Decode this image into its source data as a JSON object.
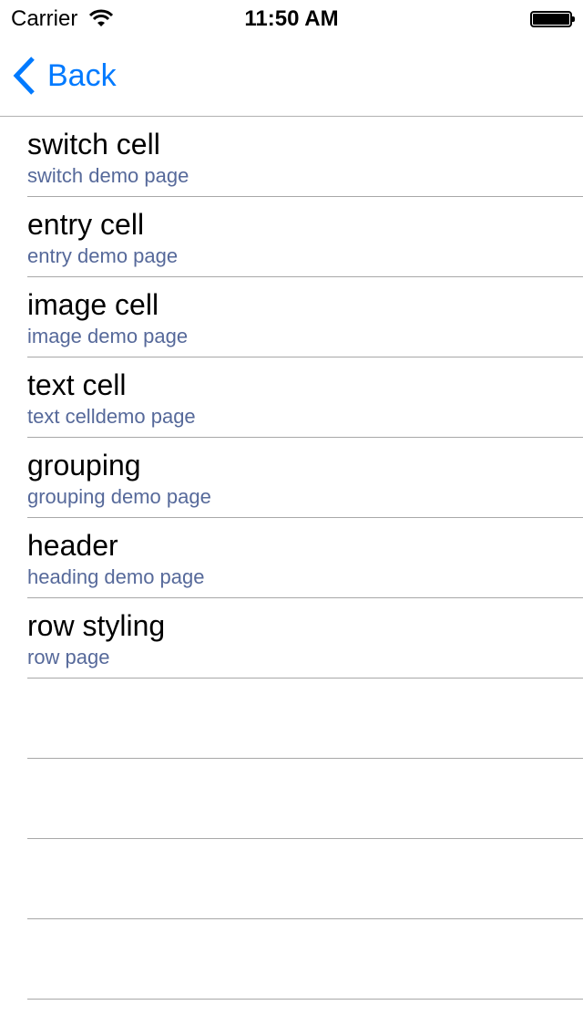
{
  "status": {
    "carrier": "Carrier",
    "time": "11:50 AM"
  },
  "nav": {
    "back_label": "Back",
    "tint": "#007aff"
  },
  "rows": [
    {
      "title": "switch cell",
      "subtitle": "switch demo page"
    },
    {
      "title": "entry cell",
      "subtitle": "entry demo page"
    },
    {
      "title": "image cell",
      "subtitle": "image demo page"
    },
    {
      "title": "text cell",
      "subtitle": "text celldemo page"
    },
    {
      "title": "grouping",
      "subtitle": "grouping demo page"
    },
    {
      "title": "header",
      "subtitle": "heading demo page"
    },
    {
      "title": "row styling",
      "subtitle": "row page"
    }
  ],
  "empty_rows": 4
}
